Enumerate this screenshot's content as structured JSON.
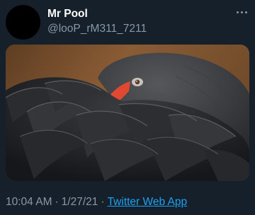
{
  "tweet": {
    "author": {
      "display_name": "Mr Pool",
      "handle": "@looP_rM311_7211"
    },
    "timestamp": {
      "time": "10:04 AM",
      "date": "1/27/21",
      "separator": "·"
    },
    "source": {
      "label": "Twitter Web App"
    },
    "more_icon": "more-horizontal-icon"
  },
  "colors": {
    "background": "#15202b",
    "primary_text": "#ffffff",
    "secondary_text": "#8899a6",
    "link": "#1da1f2"
  }
}
